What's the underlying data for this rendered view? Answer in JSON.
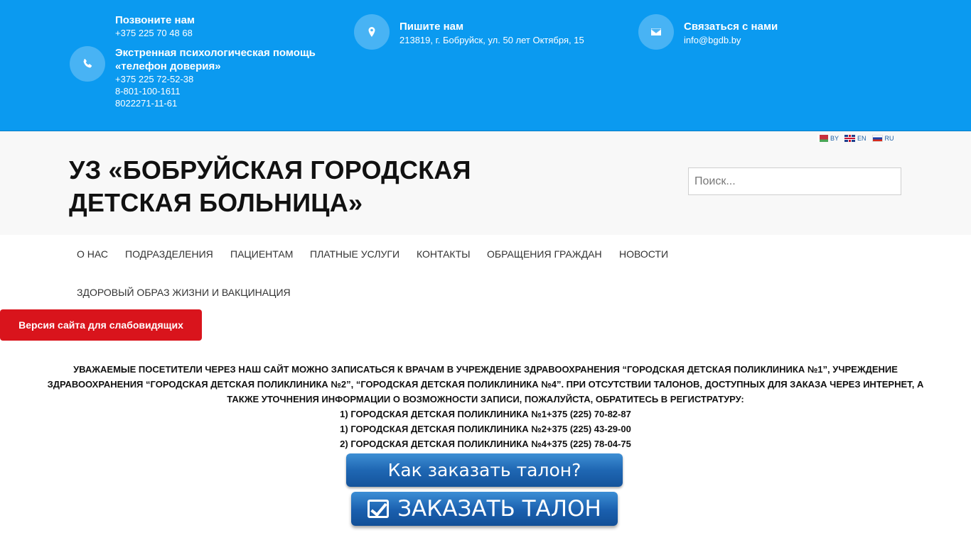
{
  "topbar": {
    "call": {
      "title": "Позвоните нам",
      "phone": "+375 225 70 48 68",
      "emergency_title_1": "Экстренная психологическая помощь",
      "emergency_title_2": "«телефон доверия»",
      "emergency_phone_1": "+375 225 72-52-38",
      "emergency_phone_2": "8-801-100-1611",
      "emergency_phone_3": "8022271-11-61"
    },
    "write": {
      "title": "Пишите нам",
      "address": "213819, г. Бобруйск, ул. 50 лет Октября, 15"
    },
    "contact": {
      "title": "Связаться с нами",
      "email": "info@bgdb.by"
    }
  },
  "header": {
    "title_line1": "УЗ «БОБРУЙСКАЯ ГОРОДСКАЯ",
    "title_line2": "ДЕТСКАЯ БОЛЬНИЦА»",
    "languages": [
      "BY",
      "EN",
      "RU"
    ],
    "search_placeholder": "Поиск..."
  },
  "nav": {
    "items": [
      "О НАС",
      "ПОДРАЗДЕЛЕНИЯ",
      "ПАЦИЕНТАМ",
      "ПЛАТНЫЕ УСЛУГИ",
      "КОНТАКТЫ",
      "ОБРАЩЕНИЯ ГРАЖДАН",
      "НОВОСТИ",
      "ЗДОРОВЫЙ ОБРАЗ ЖИЗНИ И ВАКЦИНАЦИЯ"
    ]
  },
  "accessibility_button": "Версия сайта для слабовидящих",
  "notice": {
    "line1": "УВАЖАЕМЫЕ ПОСЕТИТЕЛИ ЧЕРЕЗ НАШ САЙТ МОЖНО ЗАПИСАТЬСЯ К ВРАЧАМ В УЧРЕЖДЕНИЕ ЗДРАВООХРАНЕНИЯ “ГОРОДСКАЯ ДЕТСКАЯ ПОЛИКЛИНИКА №1”, УЧРЕЖДЕНИЕ",
    "line2": "ЗДРАВООХРАНЕНИЯ “ГОРОДСКАЯ ДЕТСКАЯ ПОЛИКЛИНИКА №2”, “ГОРОДСКАЯ ДЕТСКАЯ ПОЛИКЛИНИКА №4”.  ПРИ ОТСУТСТВИИ ТАЛОНОВ, ДОСТУПНЫХ ДЛЯ ЗАКАЗА ЧЕРЕЗ ИНТЕРНЕТ, А",
    "line3": "ТАКЖЕ  УТОЧНЕНИЯ ИНФОРМАЦИИ О ВОЗМОЖНОСТИ ЗАПИСИ, ПОЖАЛУЙСТА, ОБРАТИТЕСЬ В РЕГИСТРАТУРУ:",
    "phones": [
      "1) ГОРОДСКАЯ ДЕТСКАЯ ПОЛИКЛИНИКА №1+375 (225) 70-82-87",
      "1) ГОРОДСКАЯ ДЕТСКАЯ ПОЛИКЛИНИКА №2+375 (225) 43-29-00",
      "2) ГОРОДСКАЯ ДЕТСКАЯ ПОЛИКЛИНИКА №4+375 (225) 78-04-75"
    ]
  },
  "banners": {
    "how_to_order": "Как заказать талон?",
    "order_ticket": "ЗАКАЗАТЬ ТАЛОН"
  },
  "colors": {
    "topbar_bg": "#0b9af0",
    "header_bg": "#f8f8f8",
    "accessibility_red": "#d9141c",
    "banner_blue": "#1f67b3"
  },
  "icons": [
    "phone-icon",
    "map-marker-icon",
    "envelope-icon",
    "flag-by-icon",
    "flag-en-icon",
    "flag-ru-icon",
    "checkbox-icon"
  ]
}
